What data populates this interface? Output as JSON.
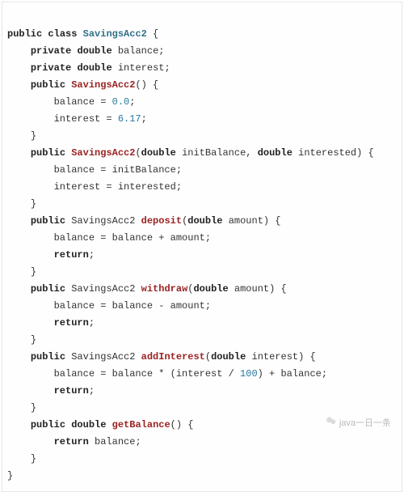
{
  "code": {
    "l1": {
      "kw1": "public",
      "kw2": "class",
      "type": "SavingsAcc2",
      "brace": " {"
    },
    "l2": {
      "kw1": "private",
      "kw2": "double",
      "id": " balance;"
    },
    "l3": {
      "kw1": "private",
      "kw2": "double",
      "id": " interest;"
    },
    "l4": {
      "kw1": "public",
      "method": "SavingsAcc2",
      "rest": "() {"
    },
    "l5": {
      "lhs": "balance = ",
      "num": "0.0",
      "semi": ";"
    },
    "l6": {
      "lhs": "interest = ",
      "num": "6.17",
      "semi": ";"
    },
    "l7": "}",
    "l8": {
      "kw1": "public",
      "method": "SavingsAcc2",
      "p": "(",
      "kw2": "double",
      "arg1": " initBalance, ",
      "kw3": "double",
      "arg2": " interested) {"
    },
    "l9": "balance = initBalance;",
    "l10": "interest = interested;",
    "l11": "}",
    "l12": {
      "kw1": "public",
      "ret": " SavingsAcc2 ",
      "method": "deposit",
      "p": "(",
      "kw2": "double",
      "arg": " amount) {"
    },
    "l13": "balance = balance + amount;",
    "l14": {
      "kw": "return",
      "tail": ";"
    },
    "l15": "}",
    "l16": {
      "kw1": "public",
      "ret": " SavingsAcc2 ",
      "method": "withdraw",
      "p": "(",
      "kw2": "double",
      "arg": " amount) {"
    },
    "l17": "balance = balance - amount;",
    "l18": {
      "kw": "return",
      "tail": ";"
    },
    "l19": "}",
    "l20": {
      "kw1": "public",
      "ret": " SavingsAcc2 ",
      "method": "addInterest",
      "p": "(",
      "kw2": "double",
      "arg": " interest) {"
    },
    "l21_a": "balance = balance * (interest / ",
    "l21_num": "100",
    "l21_b": ") + balance;",
    "l22": {
      "kw": "return",
      "tail": ";"
    },
    "l23": "}",
    "l24": {
      "kw1": "public",
      "kw2": "double",
      "method": "getBalance",
      "rest": "() {"
    },
    "l25": {
      "kw": "return",
      "tail": " balance;"
    },
    "l26": "}",
    "l27": "}"
  },
  "watermark": {
    "label": "java一日一条"
  }
}
